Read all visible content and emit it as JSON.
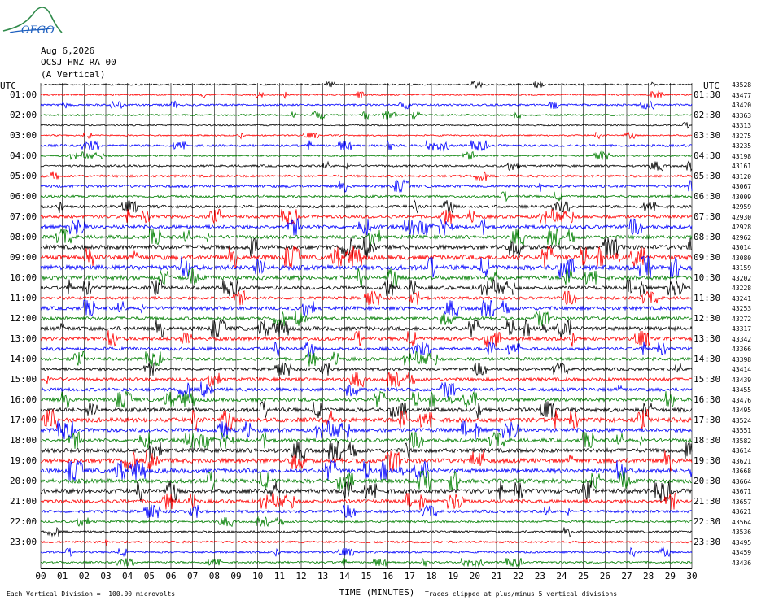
{
  "logo": {
    "text": "OFGO",
    "colors": [
      "#2f8a4a",
      "#1d5fbf"
    ]
  },
  "header": {
    "date": "Aug 6,2026",
    "station": "OCSJ HNZ RA 00",
    "component": "(A Vertical)"
  },
  "utc_left": "UTC",
  "utc_right": "UTC",
  "footer": {
    "left": "Each Vertical Division =  100.00 microvolts",
    "xlabel": "TIME (MINUTES)",
    "right": "Traces clipped at plus/minus 5 vertical divisions"
  },
  "chart_data": {
    "type": "line",
    "title": "",
    "xlabel": "TIME (MINUTES)",
    "xlim": [
      0,
      30
    ],
    "x_ticks": [
      "00",
      "01",
      "02",
      "03",
      "04",
      "05",
      "06",
      "07",
      "08",
      "09",
      "10",
      "11",
      "12",
      "13",
      "14",
      "15",
      "16",
      "17",
      "18",
      "19",
      "20",
      "21",
      "22",
      "23",
      "24",
      "25",
      "26",
      "27",
      "28",
      "29",
      "30"
    ],
    "trace_colors": [
      "#000000",
      "#ff0000",
      "#0000ff",
      "#007f00"
    ],
    "left_labels": [
      "01:00",
      "02:00",
      "03:00",
      "04:00",
      "05:00",
      "06:00",
      "07:00",
      "08:00",
      "09:00",
      "10:00",
      "11:00",
      "12:00",
      "13:00",
      "14:00",
      "15:00",
      "16:00",
      "17:00",
      "18:00",
      "19:00",
      "20:00",
      "21:00",
      "22:00",
      "23:00"
    ],
    "right_labels": [
      "01:30",
      "02:30",
      "03:30",
      "04:30",
      "05:30",
      "06:30",
      "07:30",
      "08:30",
      "09:30",
      "10:30",
      "11:30",
      "12:30",
      "13:30",
      "14:30",
      "15:30",
      "16:30",
      "17:30",
      "18:30",
      "19:30",
      "20:30",
      "21:30",
      "22:30",
      "23:30"
    ],
    "counts": [
      "43528",
      "43477",
      "43420",
      "43363",
      "43313",
      "43275",
      "43235",
      "43198",
      "43161",
      "43120",
      "43067",
      "43009",
      "42959",
      "42930",
      "42928",
      "42962",
      "43014",
      "43080",
      "43159",
      "43202",
      "43228",
      "43241",
      "43253",
      "43272",
      "43317",
      "43342",
      "43366",
      "43398",
      "43414",
      "43439",
      "43455",
      "43476",
      "43495",
      "43524",
      "43551",
      "43582",
      "43614",
      "43621",
      "43668",
      "43664",
      "43671",
      "43657",
      "43621",
      "43564",
      "43536",
      "43495",
      "43459",
      "43436"
    ],
    "activity": [
      0.15,
      0.15,
      0.25,
      0.2,
      0.12,
      0.12,
      0.35,
      0.2,
      0.3,
      0.35,
      0.45,
      0.35,
      0.5,
      0.6,
      0.7,
      0.7,
      0.95,
      1.0,
      1.0,
      0.85,
      0.7,
      0.55,
      0.7,
      0.65,
      0.8,
      0.7,
      0.6,
      0.6,
      0.5,
      0.6,
      0.65,
      0.7,
      0.8,
      0.95,
      0.8,
      0.7,
      0.85,
      0.95,
      0.95,
      0.9,
      0.95,
      0.7,
      0.5,
      0.3,
      0.3,
      0.3,
      0.25,
      0.25
    ]
  }
}
